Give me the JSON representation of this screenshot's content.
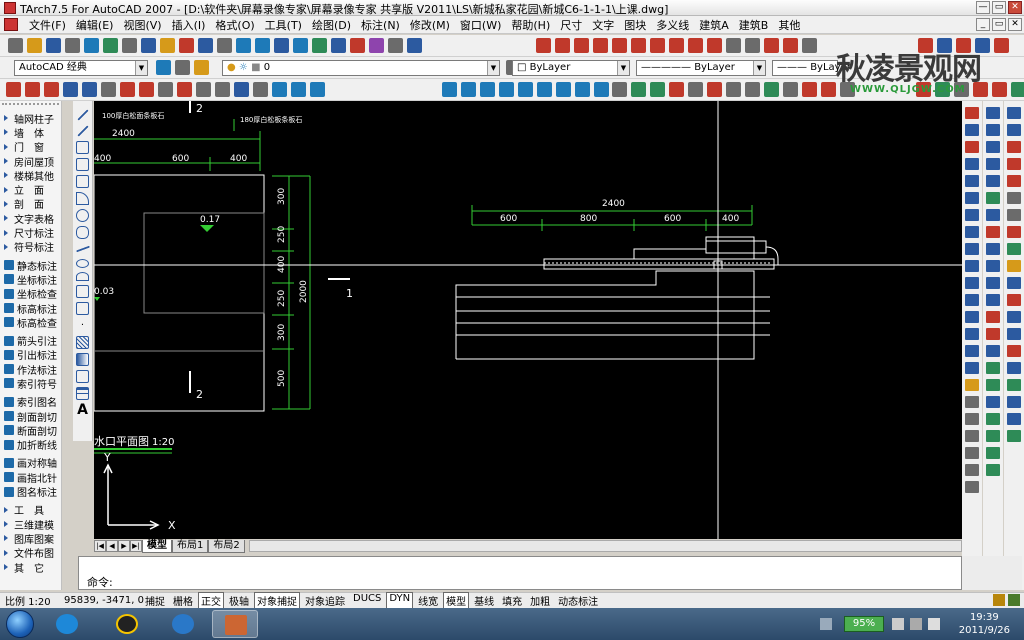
{
  "window": {
    "title": "TArch7.5 For AutoCAD 2007 - [D:\\软件夹\\屏幕录像专家\\屏幕录像专家 共享版 V2011\\LS\\新城私家花园\\新城C6-1-1-1\\上课.dwg]"
  },
  "menu": [
    "文件(F)",
    "编辑(E)",
    "视图(V)",
    "插入(I)",
    "格式(O)",
    "工具(T)",
    "绘图(D)",
    "标注(N)",
    "修改(M)",
    "窗口(W)",
    "帮助(H)",
    "尺寸",
    "文字",
    "图块",
    "多义线",
    "建筑A",
    "建筑B",
    "其他"
  ],
  "toolbar": {
    "workspace": "AutoCAD 经典",
    "layer": "0",
    "color": "ByLayer",
    "linetype": "ByLayer",
    "lineweight": "ByLayer"
  },
  "watermark": {
    "text": "秋凌景观网",
    "url": "WWW.QLJGW.COM"
  },
  "tarch_menu": [
    "轴网柱子",
    "墙　体",
    "门　窗",
    "房间屋顶",
    "楼梯其他",
    "立　面",
    "剖　面",
    "文字表格",
    "尺寸标注",
    "符号标注",
    "静态标注",
    "坐标标注",
    "坐标检查",
    "标高标注",
    "标高检查",
    "箭头引注",
    "引出标注",
    "作法标注",
    "索引符号",
    "索引图名",
    "剖面剖切",
    "断面剖切",
    "加折断线",
    "画对称轴",
    "画指北针",
    "图名标注",
    "工　具",
    "三维建模",
    "图库图案",
    "文件布图",
    "其　它"
  ],
  "drawing": {
    "dims_left_top": [
      "100厚白松面条板石",
      "180厚白松板条板石",
      "2400",
      "400",
      "600",
      "400"
    ],
    "dims_left_vertical": [
      "300",
      "250",
      "400",
      "250",
      "300",
      "500",
      "2000"
    ],
    "level_marks": [
      "0.17",
      "0.03"
    ],
    "section_marks": [
      "2",
      "1",
      "2"
    ],
    "view_title": "水口平面图",
    "view_scale": "1:20",
    "dims_right": [
      "2400",
      "600",
      "800",
      "600",
      "400"
    ],
    "ucs_x": "X",
    "ucs_y": "Y"
  },
  "tabs": [
    "模型",
    "布局1",
    "布局2"
  ],
  "command": {
    "prompt": "命令:"
  },
  "status": {
    "scale": "比例 1:20",
    "coords": "95839, -3471, 0",
    "buttons": [
      {
        "label": "捕捉",
        "on": false
      },
      {
        "label": "栅格",
        "on": false
      },
      {
        "label": "正交",
        "on": true
      },
      {
        "label": "极轴",
        "on": false
      },
      {
        "label": "对象捕捉",
        "on": true
      },
      {
        "label": "对象追踪",
        "on": false
      },
      {
        "label": "DUCS",
        "on": false
      },
      {
        "label": "DYN",
        "on": true
      },
      {
        "label": "线宽",
        "on": false
      },
      {
        "label": "模型",
        "on": true
      },
      {
        "label": "基线",
        "on": false
      },
      {
        "label": "填充",
        "on": false
      },
      {
        "label": "加粗",
        "on": false
      },
      {
        "label": "动态标注",
        "on": false
      }
    ]
  },
  "taskbar": {
    "battery": "95%",
    "time": "19:39",
    "date": "2011/9/26"
  }
}
